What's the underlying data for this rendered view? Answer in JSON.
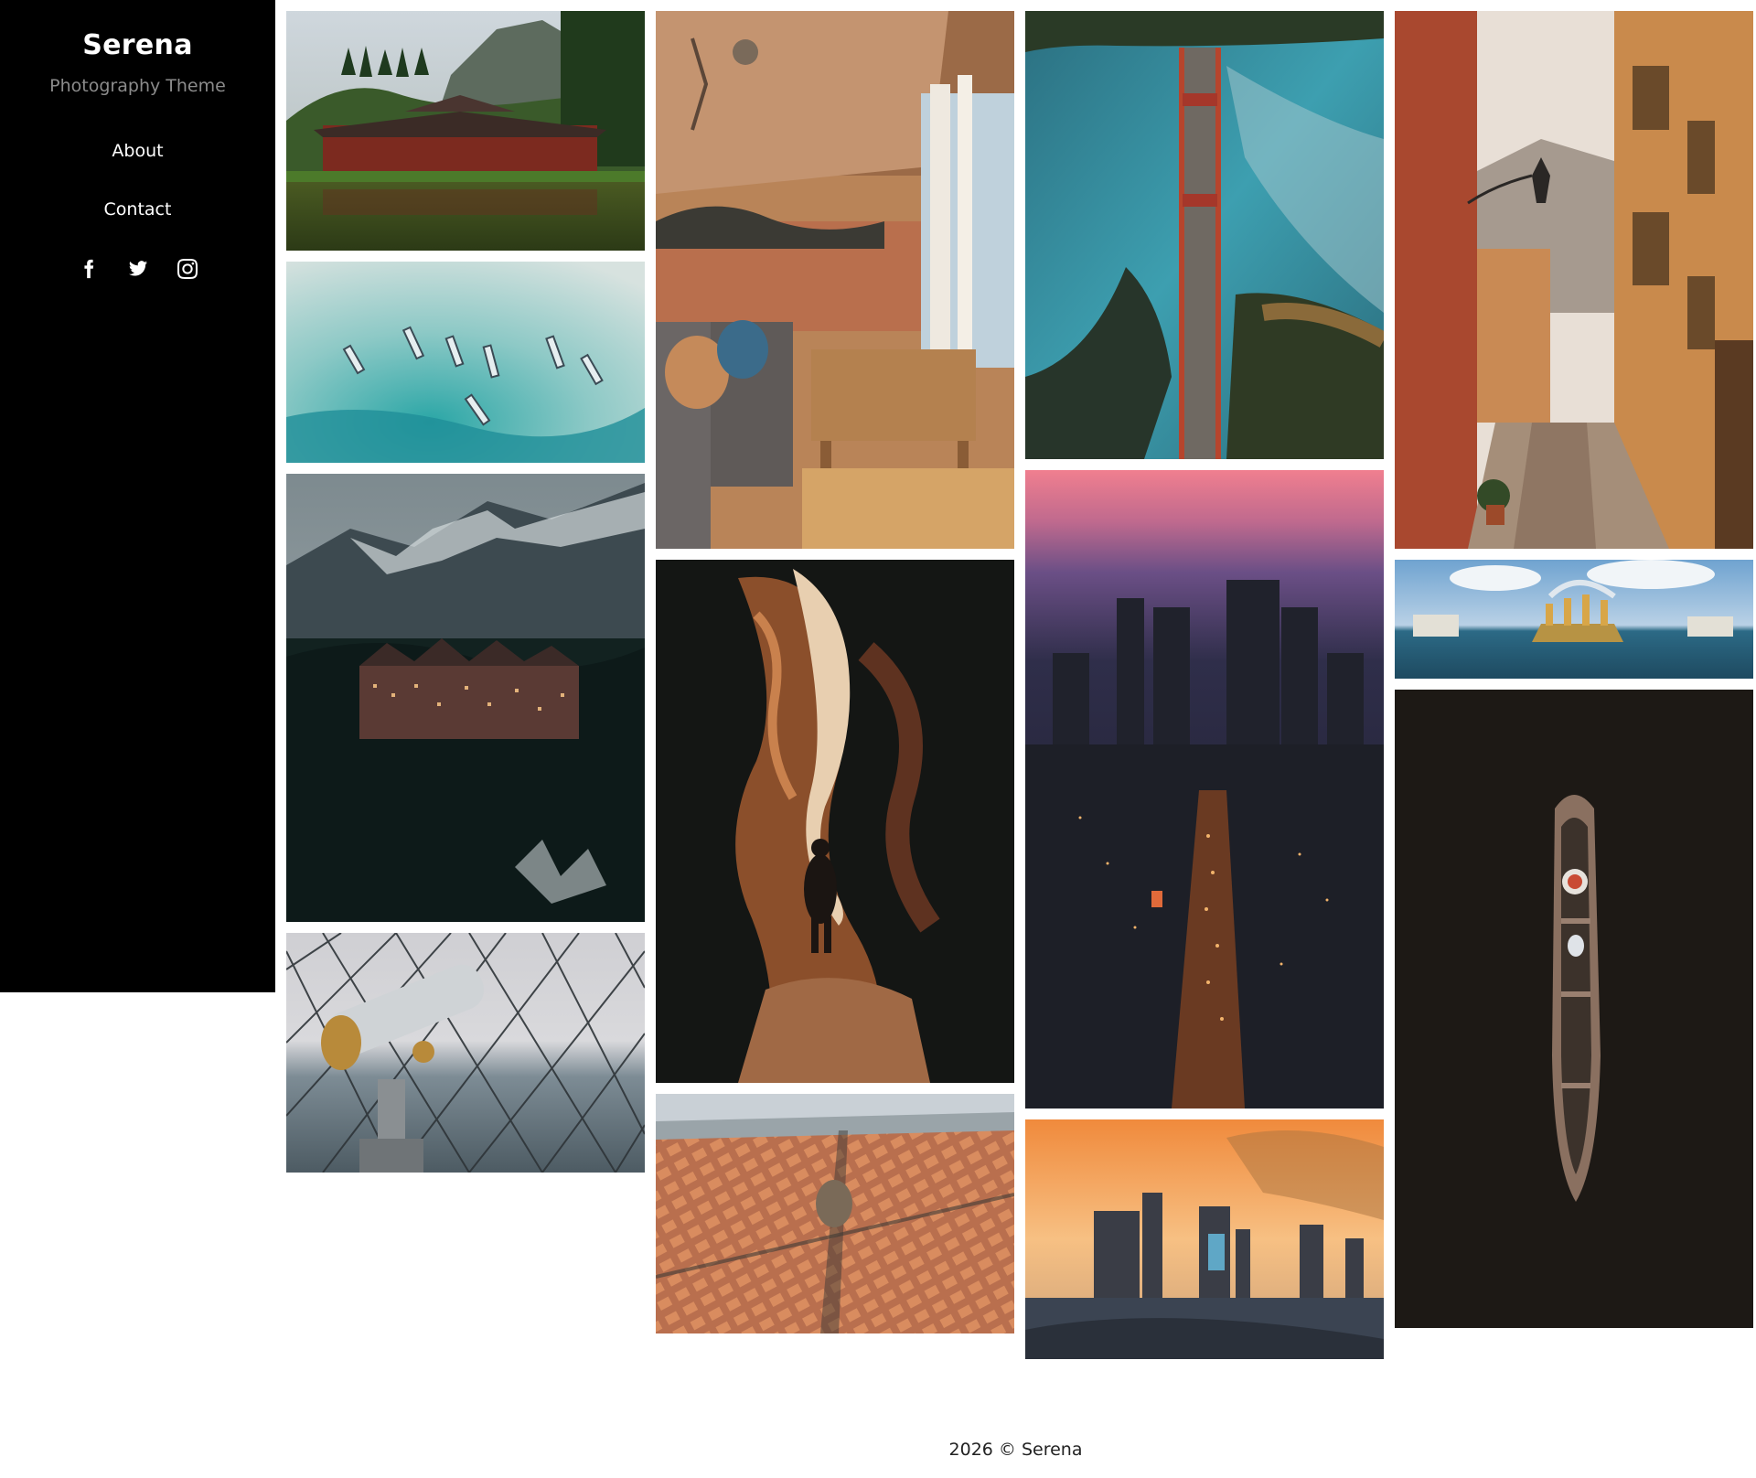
{
  "site": {
    "title": "Serena",
    "tagline": "Photography Theme"
  },
  "nav": {
    "items": [
      {
        "label": "About"
      },
      {
        "label": "Contact"
      }
    ]
  },
  "social": {
    "icons": [
      "facebook-icon",
      "twitter-icon",
      "instagram-icon"
    ]
  },
  "gallery": {
    "photos": [
      {
        "subject": "japanese-temple-lake"
      },
      {
        "subject": "boats-aerial-sea"
      },
      {
        "subject": "castle-hotel-mountains"
      },
      {
        "subject": "telescope-city-fence"
      },
      {
        "subject": "lounge-terrace"
      },
      {
        "subject": "sandstone-canyon-person"
      },
      {
        "subject": "city-grid-aerial"
      },
      {
        "subject": "golden-gate-bridge-aerial"
      },
      {
        "subject": "city-skyline-dusk"
      },
      {
        "subject": "skyscrapers-sunset"
      },
      {
        "subject": "italian-alley-stairs"
      },
      {
        "subject": "golden-fountain"
      },
      {
        "subject": "rowing-boat-aerial"
      }
    ]
  },
  "footer": {
    "text": "2026 © Serena"
  }
}
